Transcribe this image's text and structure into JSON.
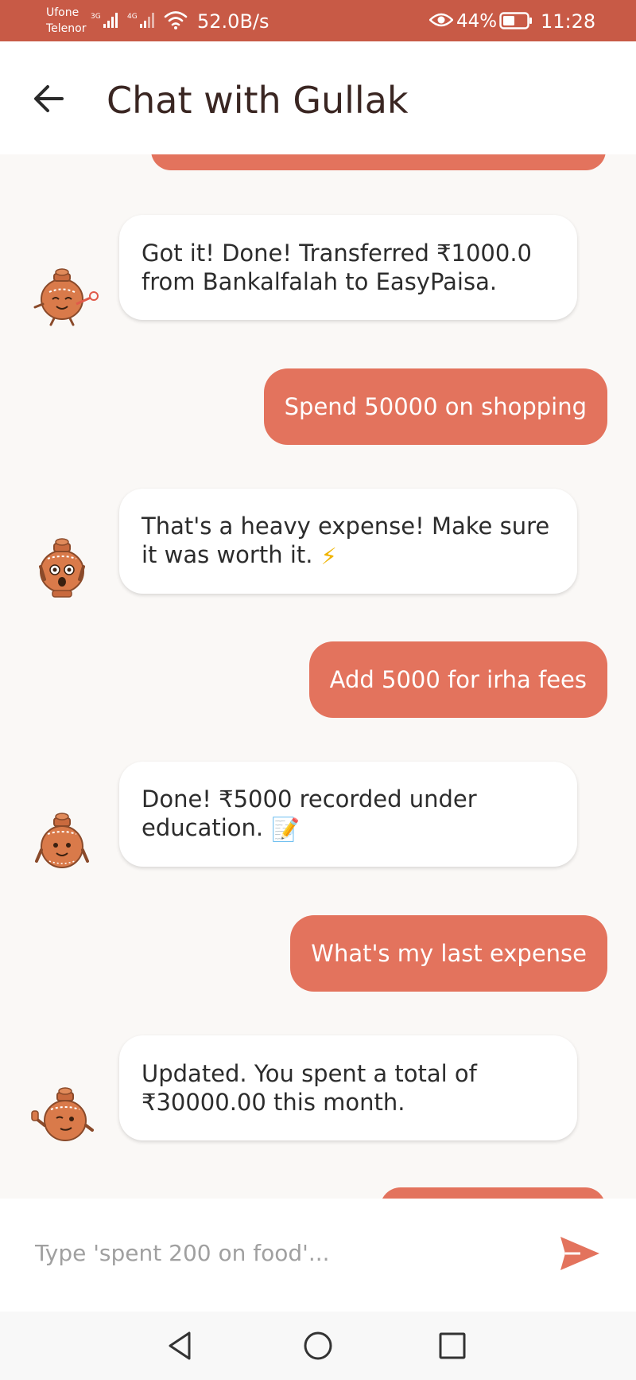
{
  "status_bar": {
    "carrier_1": "Ufone",
    "carrier_2": "Telenor",
    "signal_1_type": "3G",
    "signal_2_type": "4G",
    "net_speed": "52.0B/s",
    "battery": "44%",
    "time": "11:28"
  },
  "header": {
    "title": "Chat with Gullak"
  },
  "messages": [
    {
      "sender": "bot",
      "avatar": "gullak-party-icon",
      "text": "Got it! Done! Transferred ₹1000.0 from Bankalfalah to EasyPaisa."
    },
    {
      "sender": "user",
      "text": "Spend 50000 on shopping"
    },
    {
      "sender": "bot",
      "avatar": "gullak-shocked-icon",
      "text": "That's a heavy expense! Make sure it was worth it.",
      "emoji": "⚡"
    },
    {
      "sender": "user",
      "text": "Add 5000 for irha fees"
    },
    {
      "sender": "bot",
      "avatar": "gullak-smile-icon",
      "text": "Done! ₹5000 recorded under education.",
      "emoji": "📝"
    },
    {
      "sender": "user",
      "text": "What's my last expense"
    },
    {
      "sender": "bot",
      "avatar": "gullak-thumbs-up-icon",
      "text": "Updated. You spent a total of ₹30000.00 this month."
    }
  ],
  "input": {
    "placeholder": "Type 'spent 200 on food'..."
  },
  "colors": {
    "status_bar": "#c85a46",
    "user_bubble": "#e3735d",
    "bot_bubble": "#ffffff",
    "chat_background": "#faf8f6",
    "title_text": "#3a2622"
  }
}
